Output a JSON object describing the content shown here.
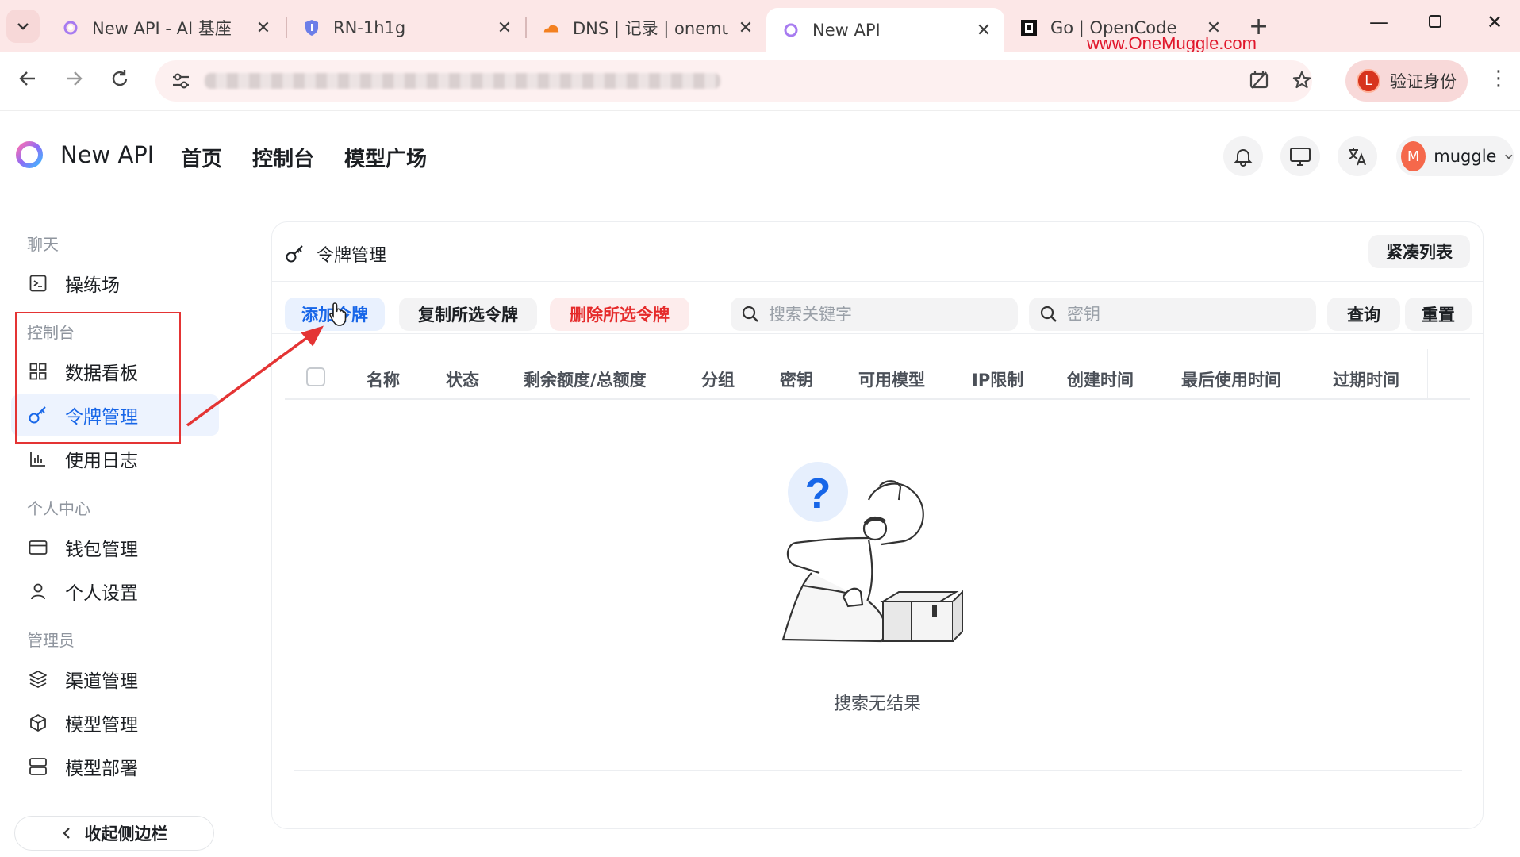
{
  "browser": {
    "tabs": [
      {
        "title": "New API - AI 基座",
        "icon": "newapi-icon",
        "active": false
      },
      {
        "title": "RN-1h1g",
        "icon": "shield-icon",
        "active": false
      },
      {
        "title": "DNS | 记录 | onemug",
        "icon": "cloudflare-icon",
        "active": false
      },
      {
        "title": "New API",
        "icon": "newapi-icon",
        "active": true
      },
      {
        "title": "Go | OpenCode",
        "icon": "opencode-icon",
        "active": false
      }
    ],
    "watermark": "www.OneMuggle.com",
    "verify_label": "验证身份",
    "verify_avatar": "L"
  },
  "header": {
    "brand": "New API",
    "nav": [
      "首页",
      "控制台",
      "模型广场"
    ],
    "user_initial": "M",
    "username": "muggle"
  },
  "sidebar": {
    "sections": [
      {
        "label": "聊天",
        "items": [
          {
            "label": "操练场",
            "icon": "playground-icon"
          }
        ]
      },
      {
        "label": "控制台",
        "items": [
          {
            "label": "数据看板",
            "icon": "dashboard-icon"
          },
          {
            "label": "令牌管理",
            "icon": "key-icon",
            "active": true
          },
          {
            "label": "使用日志",
            "icon": "chart-icon"
          }
        ]
      },
      {
        "label": "个人中心",
        "items": [
          {
            "label": "钱包管理",
            "icon": "wallet-icon"
          },
          {
            "label": "个人设置",
            "icon": "user-icon"
          }
        ]
      },
      {
        "label": "管理员",
        "items": [
          {
            "label": "渠道管理",
            "icon": "layers-icon"
          },
          {
            "label": "模型管理",
            "icon": "box-icon"
          },
          {
            "label": "模型部署",
            "icon": "server-icon"
          }
        ]
      }
    ],
    "collapse_label": "收起侧边栏"
  },
  "main": {
    "title": "令牌管理",
    "compact_label": "紧凑列表",
    "buttons": {
      "add": "添加令牌",
      "copy": "复制所选令牌",
      "delete": "删除所选令牌",
      "query": "查询",
      "reset": "重置"
    },
    "search_keyword_placeholder": "搜索关键字",
    "search_key_placeholder": "密钥",
    "columns": [
      "名称",
      "状态",
      "剩余额度/总额度",
      "分组",
      "密钥",
      "可用模型",
      "IP限制",
      "创建时间",
      "最后使用时间",
      "过期时间"
    ],
    "empty_text": "搜索无结果"
  },
  "colors": {
    "accent": "#1766e8",
    "danger": "#e52b2b",
    "annotation": "#e43434"
  }
}
